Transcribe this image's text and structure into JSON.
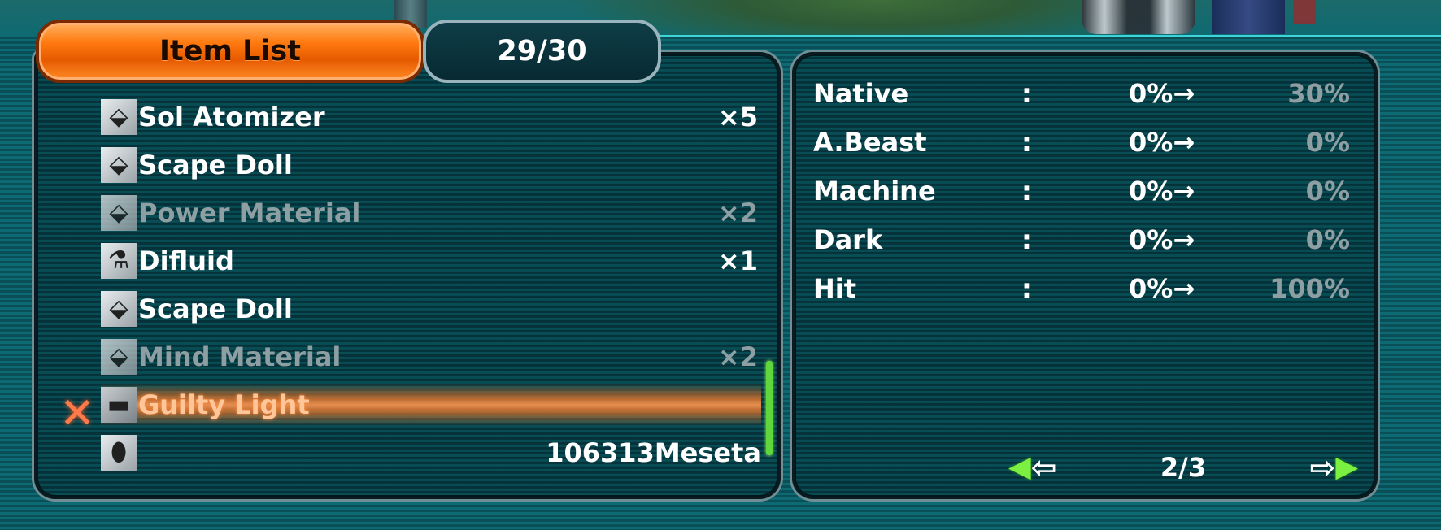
{
  "title_tab": {
    "label": "Item List"
  },
  "count_tab": {
    "label": "29/30"
  },
  "items": [
    {
      "icon": "diamond-icon",
      "name": "Sol Atomizer",
      "qty": "×5",
      "state": "normal"
    },
    {
      "icon": "diamond-icon",
      "name": "Scape Doll",
      "qty": "",
      "state": "normal"
    },
    {
      "icon": "diamond-icon",
      "name": "Power Material",
      "qty": "×2",
      "state": "dim"
    },
    {
      "icon": "flask-icon",
      "name": "Difluid",
      "qty": "×1",
      "state": "normal"
    },
    {
      "icon": "diamond-icon",
      "name": "Scape Doll",
      "qty": "",
      "state": "normal"
    },
    {
      "icon": "diamond-icon",
      "name": "Mind Material",
      "qty": "×2",
      "state": "dim"
    },
    {
      "icon": "gun-icon",
      "name": "Guilty Light",
      "qty": "",
      "state": "selected"
    }
  ],
  "meseta": {
    "icon": "meseta-icon",
    "amount": "106313Meseta"
  },
  "stats": [
    {
      "label": "Native",
      "sep": ":",
      "current": "0%→",
      "max": "30%"
    },
    {
      "label": "A.Beast",
      "sep": ":",
      "current": "0%→",
      "max": "0%"
    },
    {
      "label": "Machine",
      "sep": ":",
      "current": "0%→",
      "max": "0%"
    },
    {
      "label": "Dark",
      "sep": ":",
      "current": "0%→",
      "max": "0%"
    },
    {
      "label": "Hit",
      "sep": ":",
      "current": "0%→",
      "max": "100%"
    }
  ],
  "pager": {
    "page": "2/3"
  },
  "colors": {
    "accent": "#ff7a10",
    "selected_text": "#ffc69a",
    "dim_text": "#8d9fa3",
    "scroll": "#5fd63a"
  }
}
